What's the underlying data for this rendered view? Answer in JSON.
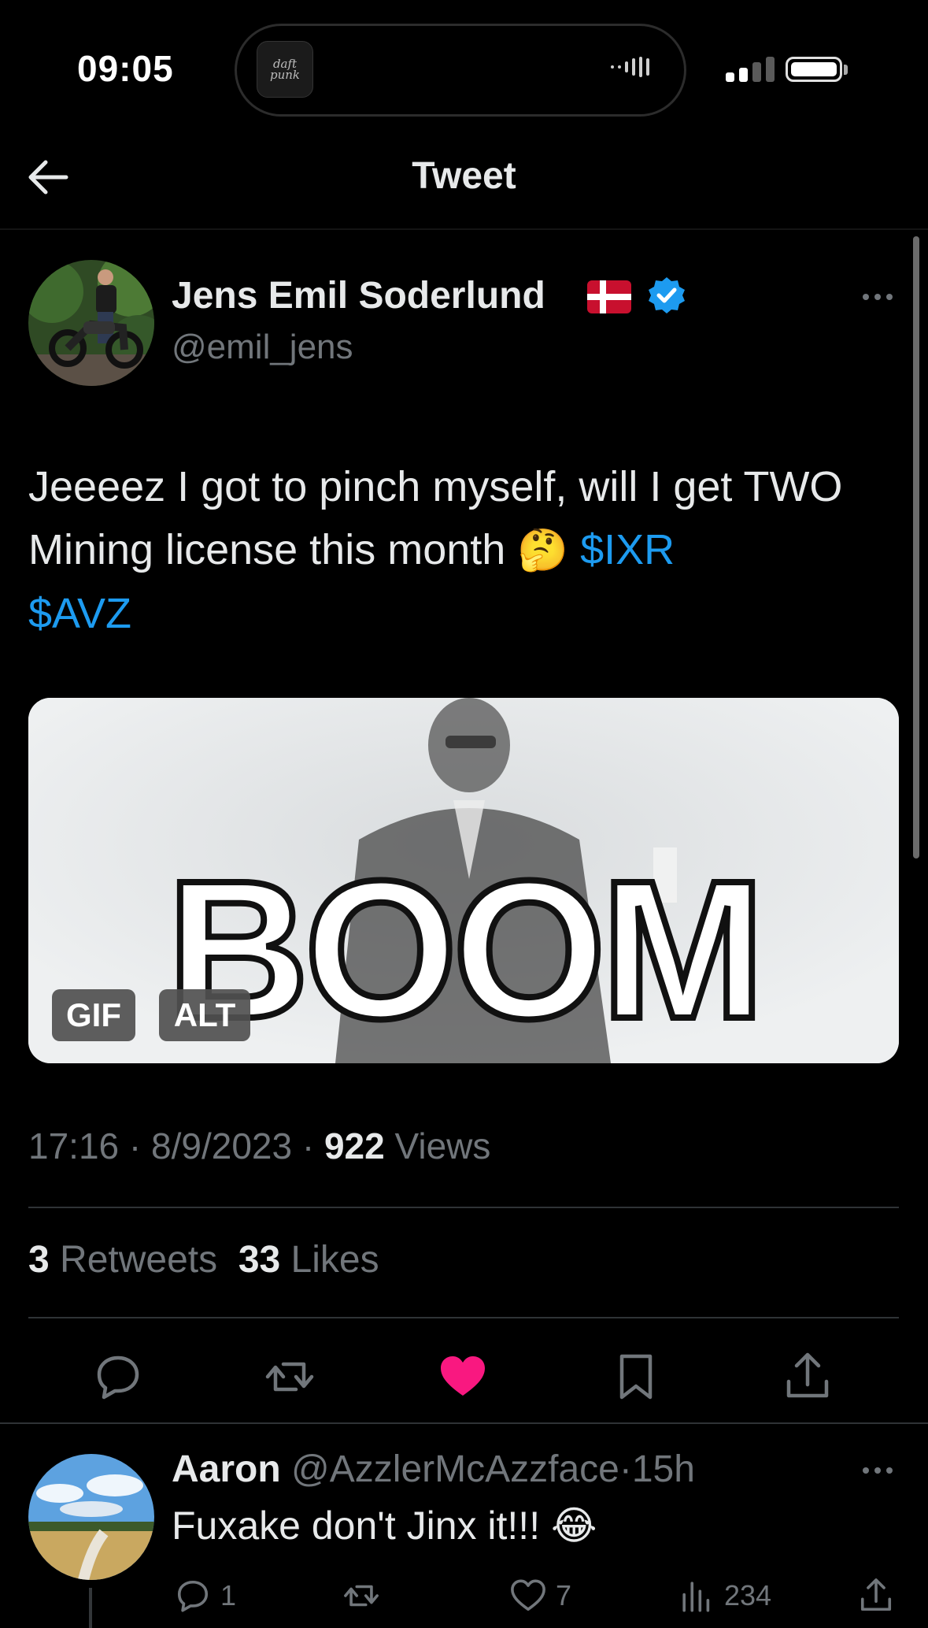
{
  "status_bar": {
    "time": "09:05",
    "now_playing_art": "daft punk"
  },
  "header": {
    "title": "Tweet"
  },
  "tweet": {
    "author_name": "Jens Emil Soderlund",
    "author_handle": "@emil_jens",
    "text_part1": "Jeeeez I got to pinch myself, will I get TWO Mining license this month",
    "emoji": "🤔",
    "cashtag1": "$IXR",
    "cashtag2": "$AVZ",
    "media": {
      "caption": "BOOM",
      "gif_badge": "GIF",
      "alt_badge": "ALT"
    },
    "time": "17:16",
    "date": "8/9/2023",
    "views_count": "922",
    "views_label": "Views",
    "retweets_count": "3",
    "retweets_label": "Retweets",
    "likes_count": "33",
    "likes_label": "Likes",
    "liked": true
  },
  "reply": {
    "author_name": "Aaron",
    "author_handle": "@AzzlerMcAzzface",
    "age": "15h",
    "text": "Fuxake don't Jinx it!!!",
    "emoji": "😂",
    "replies": "1",
    "likes": "7",
    "views": "234"
  },
  "colors": {
    "accent": "#1d9bf0",
    "like": "#f91880",
    "muted": "#71767b",
    "text": "#e7e9ea",
    "background": "#000000"
  }
}
